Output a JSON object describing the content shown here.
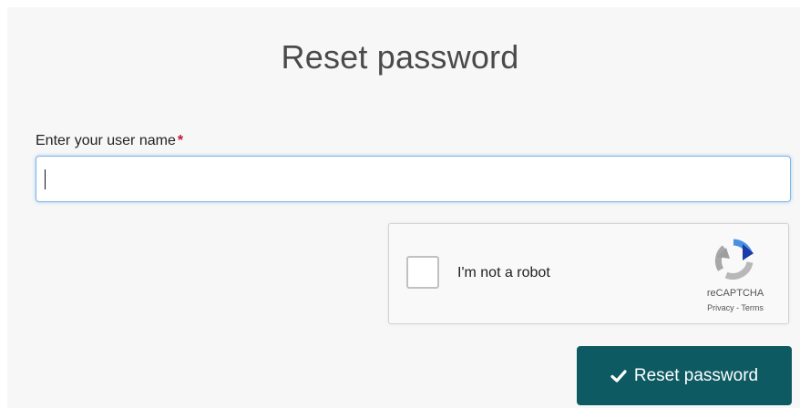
{
  "page": {
    "title": "Reset password"
  },
  "form": {
    "username_label": "Enter your user name",
    "required_marker": "*",
    "username_value": "",
    "submit_label": "Reset password"
  },
  "captcha": {
    "label": "I'm not a robot",
    "brand": "reCAPTCHA",
    "links": "Privacy - Terms",
    "checked": false
  },
  "colors": {
    "button_bg": "#0e5a63",
    "required": "#c0143c",
    "input_focus": "#7fb3e6"
  },
  "icons": {
    "submit": "checkmark-icon",
    "captcha": "recaptcha-logo-icon"
  }
}
